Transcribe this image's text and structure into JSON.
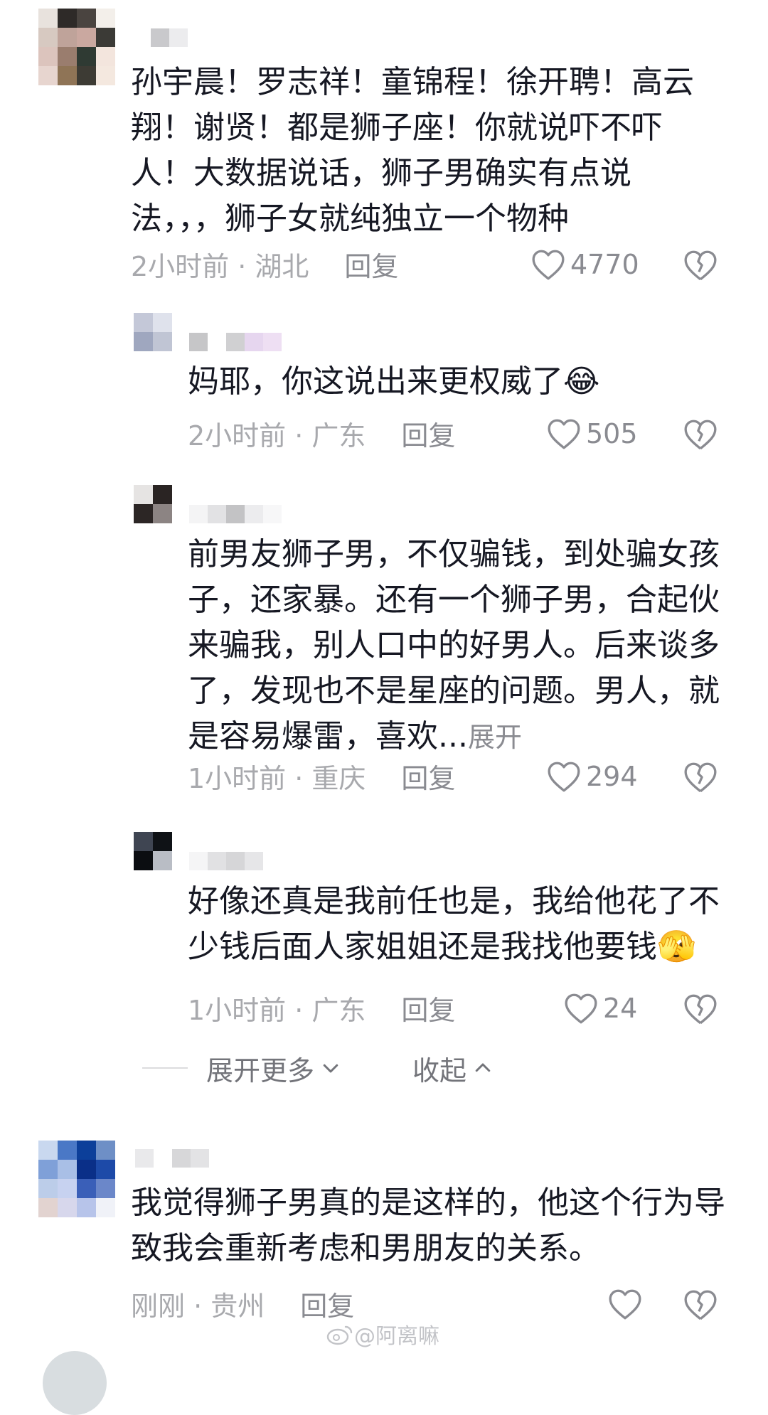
{
  "comments": [
    {
      "text": "孙宇晨！罗志祥！童锦程！徐开聘！高云翔！谢贤！都是狮子座！你就说吓不吓人！大数据说话，狮子男确实有点说法，，，狮子女就纯独立一个物种",
      "time_location": "2小时前 · 湖北",
      "reply_label": "回复",
      "likes": "4770",
      "avatar_colors": [
        "#e8e2dd",
        "#2e2a28",
        "#4a4440",
        "#f3efea",
        "#d7c9c1",
        "#bfa39a",
        "#caa8a0",
        "#3b3a36",
        "#dcc4bd",
        "#9a7d6e",
        "#2f3a33",
        "#f3e5dd",
        "#e7d5cf",
        "#8f7456",
        "#3d3b34",
        "#f4e8df"
      ],
      "name_colors": [
        "#c9c9cc",
        "#ececee"
      ]
    },
    {
      "text": "妈耶，你这说出来更权威了",
      "emoji": "😂",
      "time_location": "2小时前 · 广东",
      "reply_label": "回复",
      "likes": "505",
      "avatar_colors": [
        "#c4c8d8",
        "#dfe2ec",
        "#9fa7bf",
        "#c0c5d4"
      ],
      "name_colors": [
        "#c6c6c8",
        "#ffffff",
        "#d0d0d2",
        "#e6d6ef",
        "#eedff3"
      ]
    },
    {
      "text": "前男友狮子男，不仅骗钱，到处骗女孩子，还家暴。还有一个狮子男，合起伙来骗我，别人口中的好男人。后来谈多了，发现也不是星座的问题。男人，就是容易爆雷，喜欢...",
      "more_label": "展开",
      "time_location": "1小时前 · 重庆",
      "reply_label": "回复",
      "likes": "294",
      "avatar_colors": [
        "#e6e4e3",
        "#2a2423",
        "#2c2625",
        "#8c8483"
      ],
      "name_colors": [
        "#f4f4f5",
        "#e2e2e4",
        "#c3c3c5",
        "#ececee",
        "#f7f7f8"
      ]
    },
    {
      "text": "好像还真是我前任也是，我给他花了不少钱后面人家姐姐还是我找他要钱",
      "emoji": "🫣",
      "time_location": "1小时前 · 广东",
      "reply_label": "回复",
      "likes": "24",
      "avatar_colors": [
        "#3f4552",
        "#0f1216",
        "#0b0d11",
        "#b9bdc5"
      ],
      "name_colors": [
        "#f5f5f6",
        "#e1e1e3",
        "#d6d6d8",
        "#e6e6e8"
      ]
    },
    {
      "text": "我觉得狮子男真的是这样的，他这个行为导致我会重新考虑和男朋友的关系。",
      "time_location": "刚刚 · 贵州",
      "reply_label": "回复",
      "likes": "",
      "avatar_colors": [
        "#c9d8ef",
        "#4a78c6",
        "#0c3f9a",
        "#6e8fc6",
        "#7fa0d8",
        "#a9bfe6",
        "#0a2f88",
        "#1d4aa8",
        "#bccde9",
        "#c7d2f0",
        "#3a5fb8",
        "#6b87c9",
        "#e2d3d0",
        "#d7d7ec",
        "#b7c4ea",
        "#f0f2f8"
      ],
      "name_colors": [
        "#e9e9eb",
        "#ffffff",
        "#d7d7d9",
        "#e3e3e5"
      ]
    }
  ],
  "expand_bar": {
    "more_label": "展开更多",
    "collapse_label": "收起"
  },
  "watermark": "@阿离嘛",
  "icons": {
    "like": "heart-outline-icon",
    "dislike": "broken-heart-icon",
    "more": "chevron-down-icon",
    "collapse": "chevron-up-icon",
    "watermark": "weibo-logo-icon"
  }
}
